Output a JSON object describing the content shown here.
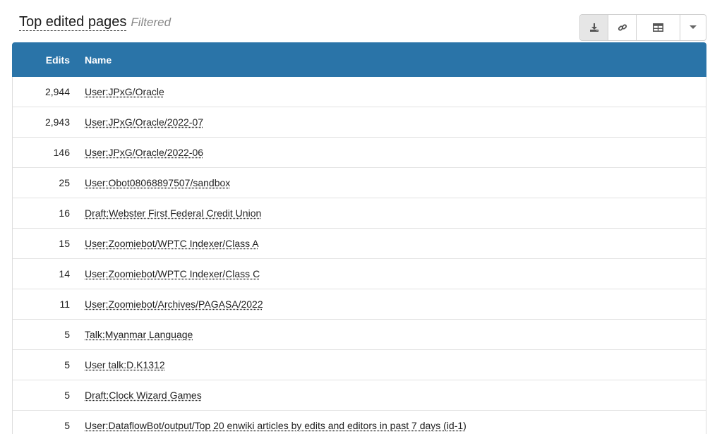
{
  "header": {
    "title": "Top edited pages",
    "subtitle": "Filtered"
  },
  "toolbar": {
    "buttons": [
      {
        "icon": "download-icon",
        "active": true
      },
      {
        "icon": "link-icon",
        "active": false
      },
      {
        "icon": "table-icon",
        "active": false
      },
      {
        "icon": "caret-down-icon",
        "active": false
      }
    ]
  },
  "table": {
    "columns": {
      "edits": "Edits",
      "name": "Name"
    },
    "rows": [
      {
        "edits": "2,944",
        "name": "User:JPxG/Oracle"
      },
      {
        "edits": "2,943",
        "name": "User:JPxG/Oracle/2022-07"
      },
      {
        "edits": "146",
        "name": "User:JPxG/Oracle/2022-06"
      },
      {
        "edits": "25",
        "name": "User:Obot08068897507/sandbox"
      },
      {
        "edits": "16",
        "name": "Draft:Webster First Federal Credit Union"
      },
      {
        "edits": "15",
        "name": "User:Zoomiebot/WPTC Indexer/Class A"
      },
      {
        "edits": "14",
        "name": "User:Zoomiebot/WPTC Indexer/Class C"
      },
      {
        "edits": "11",
        "name": "User:Zoomiebot/Archives/PAGASA/2022"
      },
      {
        "edits": "5",
        "name": "Talk:Myanmar Language"
      },
      {
        "edits": "5",
        "name": "User talk:D.K1312"
      },
      {
        "edits": "5",
        "name": "Draft:Clock Wizard Games"
      },
      {
        "edits": "5",
        "name": "User:DataflowBot/output/Top 20 enwiki articles by edits and editors in past 7 days (id-1)"
      }
    ]
  },
  "colors": {
    "header_bg": "#2a74a8",
    "active_button_bg": "#e6e6e6"
  }
}
